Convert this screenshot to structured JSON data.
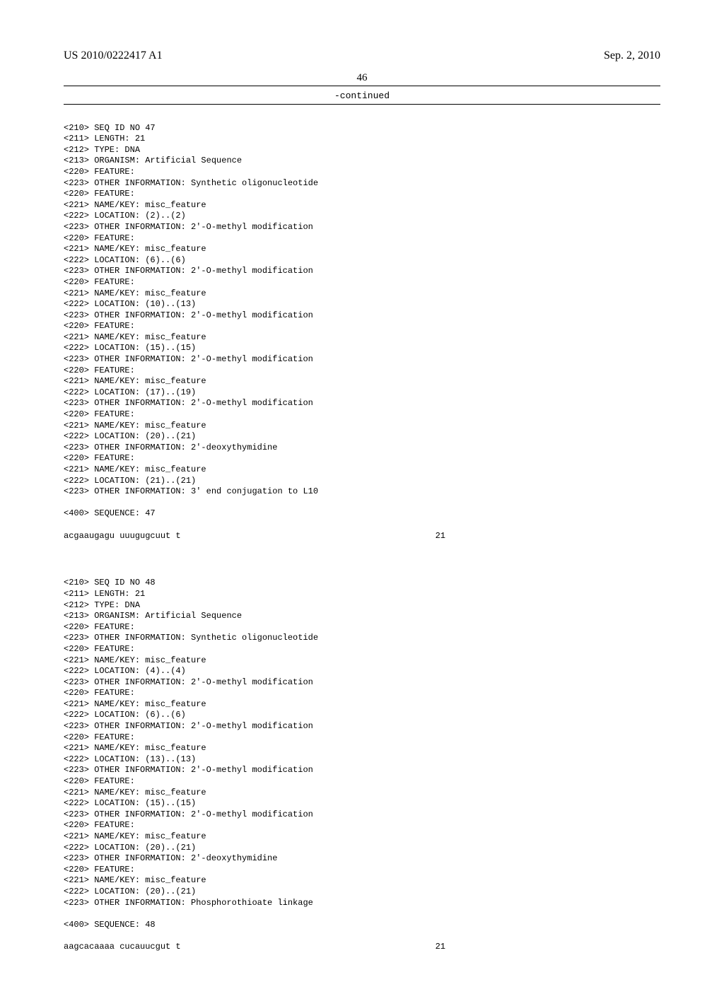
{
  "header": {
    "left": "US 2010/0222417 A1",
    "right": "Sep. 2, 2010"
  },
  "page_number": "46",
  "continued_label": "-continued",
  "seq47": {
    "lines": [
      "<210> SEQ ID NO 47",
      "<211> LENGTH: 21",
      "<212> TYPE: DNA",
      "<213> ORGANISM: Artificial Sequence",
      "<220> FEATURE:",
      "<223> OTHER INFORMATION: Synthetic oligonucleotide",
      "<220> FEATURE:",
      "<221> NAME/KEY: misc_feature",
      "<222> LOCATION: (2)..(2)",
      "<223> OTHER INFORMATION: 2'-O-methyl modification",
      "<220> FEATURE:",
      "<221> NAME/KEY: misc_feature",
      "<222> LOCATION: (6)..(6)",
      "<223> OTHER INFORMATION: 2'-O-methyl modification",
      "<220> FEATURE:",
      "<221> NAME/KEY: misc_feature",
      "<222> LOCATION: (10)..(13)",
      "<223> OTHER INFORMATION: 2'-O-methyl modification",
      "<220> FEATURE:",
      "<221> NAME/KEY: misc_feature",
      "<222> LOCATION: (15)..(15)",
      "<223> OTHER INFORMATION: 2'-O-methyl modification",
      "<220> FEATURE:",
      "<221> NAME/KEY: misc_feature",
      "<222> LOCATION: (17)..(19)",
      "<223> OTHER INFORMATION: 2'-O-methyl modification",
      "<220> FEATURE:",
      "<221> NAME/KEY: misc_feature",
      "<222> LOCATION: (20)..(21)",
      "<223> OTHER INFORMATION: 2'-deoxythymidine",
      "<220> FEATURE:",
      "<221> NAME/KEY: misc_feature",
      "<222> LOCATION: (21)..(21)",
      "<223> OTHER INFORMATION: 3' end conjugation to L10"
    ],
    "sequence_label": "<400> SEQUENCE: 47",
    "sequence": "acgaaugagu uuugugcuut t",
    "sequence_len": "21"
  },
  "seq48": {
    "lines": [
      "<210> SEQ ID NO 48",
      "<211> LENGTH: 21",
      "<212> TYPE: DNA",
      "<213> ORGANISM: Artificial Sequence",
      "<220> FEATURE:",
      "<223> OTHER INFORMATION: Synthetic oligonucleotide",
      "<220> FEATURE:",
      "<221> NAME/KEY: misc_feature",
      "<222> LOCATION: (4)..(4)",
      "<223> OTHER INFORMATION: 2'-O-methyl modification",
      "<220> FEATURE:",
      "<221> NAME/KEY: misc_feature",
      "<222> LOCATION: (6)..(6)",
      "<223> OTHER INFORMATION: 2'-O-methyl modification",
      "<220> FEATURE:",
      "<221> NAME/KEY: misc_feature",
      "<222> LOCATION: (13)..(13)",
      "<223> OTHER INFORMATION: 2'-O-methyl modification",
      "<220> FEATURE:",
      "<221> NAME/KEY: misc_feature",
      "<222> LOCATION: (15)..(15)",
      "<223> OTHER INFORMATION: 2'-O-methyl modification",
      "<220> FEATURE:",
      "<221> NAME/KEY: misc_feature",
      "<222> LOCATION: (20)..(21)",
      "<223> OTHER INFORMATION: 2'-deoxythymidine",
      "<220> FEATURE:",
      "<221> NAME/KEY: misc_feature",
      "<222> LOCATION: (20)..(21)",
      "<223> OTHER INFORMATION: Phosphorothioate linkage"
    ],
    "sequence_label": "<400> SEQUENCE: 48",
    "sequence": "aagcacaaaa cucauucgut t",
    "sequence_len": "21"
  }
}
